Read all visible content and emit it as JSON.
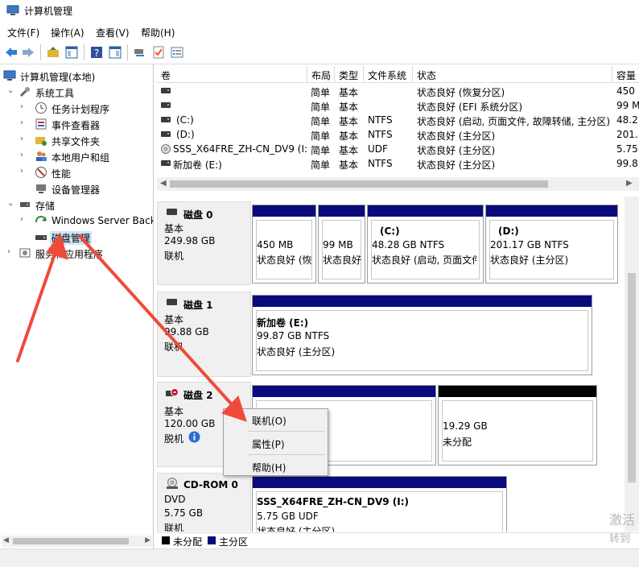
{
  "window": {
    "title": "计算机管理"
  },
  "menu": [
    "文件(F)",
    "操作(A)",
    "查看(V)",
    "帮助(H)"
  ],
  "tree": {
    "root": "计算机管理(本地)",
    "system_tools": "系统工具",
    "task_scheduler": "任务计划程序",
    "event_viewer": "事件查看器",
    "shared_folders": "共享文件夹",
    "local_users": "本地用户和组",
    "performance": "性能",
    "device_manager": "设备管理器",
    "storage": "存储",
    "windows_server_backup": "Windows Server Back",
    "disk_management": "磁盘管理",
    "services_apps": "服务和应用程序"
  },
  "volume_list": {
    "columns": [
      "卷",
      "布局",
      "类型",
      "文件系统",
      "状态",
      "容量"
    ],
    "rows": [
      {
        "volume": "",
        "layout": "简单",
        "type": "基本",
        "fs": "",
        "status": "状态良好 (恢复分区)",
        "capacity": "450"
      },
      {
        "volume": "",
        "layout": "简单",
        "type": "基本",
        "fs": "",
        "status": "状态良好 (EFI 系统分区)",
        "capacity": "99 M"
      },
      {
        "volume": "(C:)",
        "layout": "简单",
        "type": "基本",
        "fs": "NTFS",
        "status": "状态良好 (启动, 页面文件, 故障转储, 主分区)",
        "capacity": "48.2"
      },
      {
        "volume": "(D:)",
        "layout": "简单",
        "type": "基本",
        "fs": "NTFS",
        "status": "状态良好 (主分区)",
        "capacity": "201."
      },
      {
        "volume": "SSS_X64FRE_ZH-CN_DV9 (I:)",
        "layout": "简单",
        "type": "基本",
        "fs": "UDF",
        "status": "状态良好 (主分区)",
        "capacity": "5.75"
      },
      {
        "volume": "新加卷 (E:)",
        "layout": "简单",
        "type": "基本",
        "fs": "NTFS",
        "status": "状态良好 (主分区)",
        "capacity": "99.8"
      }
    ]
  },
  "disks": {
    "disk0": {
      "name": "磁盘 0",
      "type": "基本",
      "size": "249.98 GB",
      "state": "联机",
      "partitions": [
        {
          "title": "",
          "size": "450 MB",
          "status": "状态良好 (恢"
        },
        {
          "title": "",
          "size": "99 MB",
          "status": "状态良好"
        },
        {
          "title": "(C:)",
          "size": "48.28 GB NTFS",
          "status": "状态良好 (启动, 页面文件"
        },
        {
          "title": "(D:)",
          "size": "201.17 GB NTFS",
          "status": "状态良好 (主分区)"
        }
      ]
    },
    "disk1": {
      "name": "磁盘 1",
      "type": "基本",
      "size": "99.88 GB",
      "state": "联机",
      "partitions": [
        {
          "title": "新加卷 (E:)",
          "size": "99.87 GB NTFS",
          "status": "状态良好 (主分区)"
        }
      ]
    },
    "disk2": {
      "name": "磁盘 2",
      "type": "基本",
      "size": "120.00 GB",
      "state": "脱机",
      "partitions": [
        {
          "title": "",
          "size": "",
          "status": ""
        },
        {
          "title": "",
          "size": "19.29 GB",
          "status": "未分配"
        }
      ]
    },
    "cdrom0": {
      "name": "CD-ROM 0",
      "type": "DVD",
      "size": "5.75 GB",
      "state": "联机",
      "partitions": [
        {
          "title": "SSS_X64FRE_ZH-CN_DV9  (I:)",
          "size": "5.75 GB UDF",
          "status": "状态良好 (主分区)"
        }
      ]
    }
  },
  "legend": {
    "unallocated": "未分配",
    "primary": "主分区"
  },
  "context_menu": {
    "online": "联机(O)",
    "properties": "属性(P)",
    "help": "帮助(H)"
  },
  "watermark": {
    "line1": "激活",
    "line2": "转到"
  },
  "colors": {
    "primary_partition": "#0a0a7d",
    "unallocated": "#000000",
    "annotation_arrow": "#f04a3a",
    "selection": "#cce4f7"
  }
}
